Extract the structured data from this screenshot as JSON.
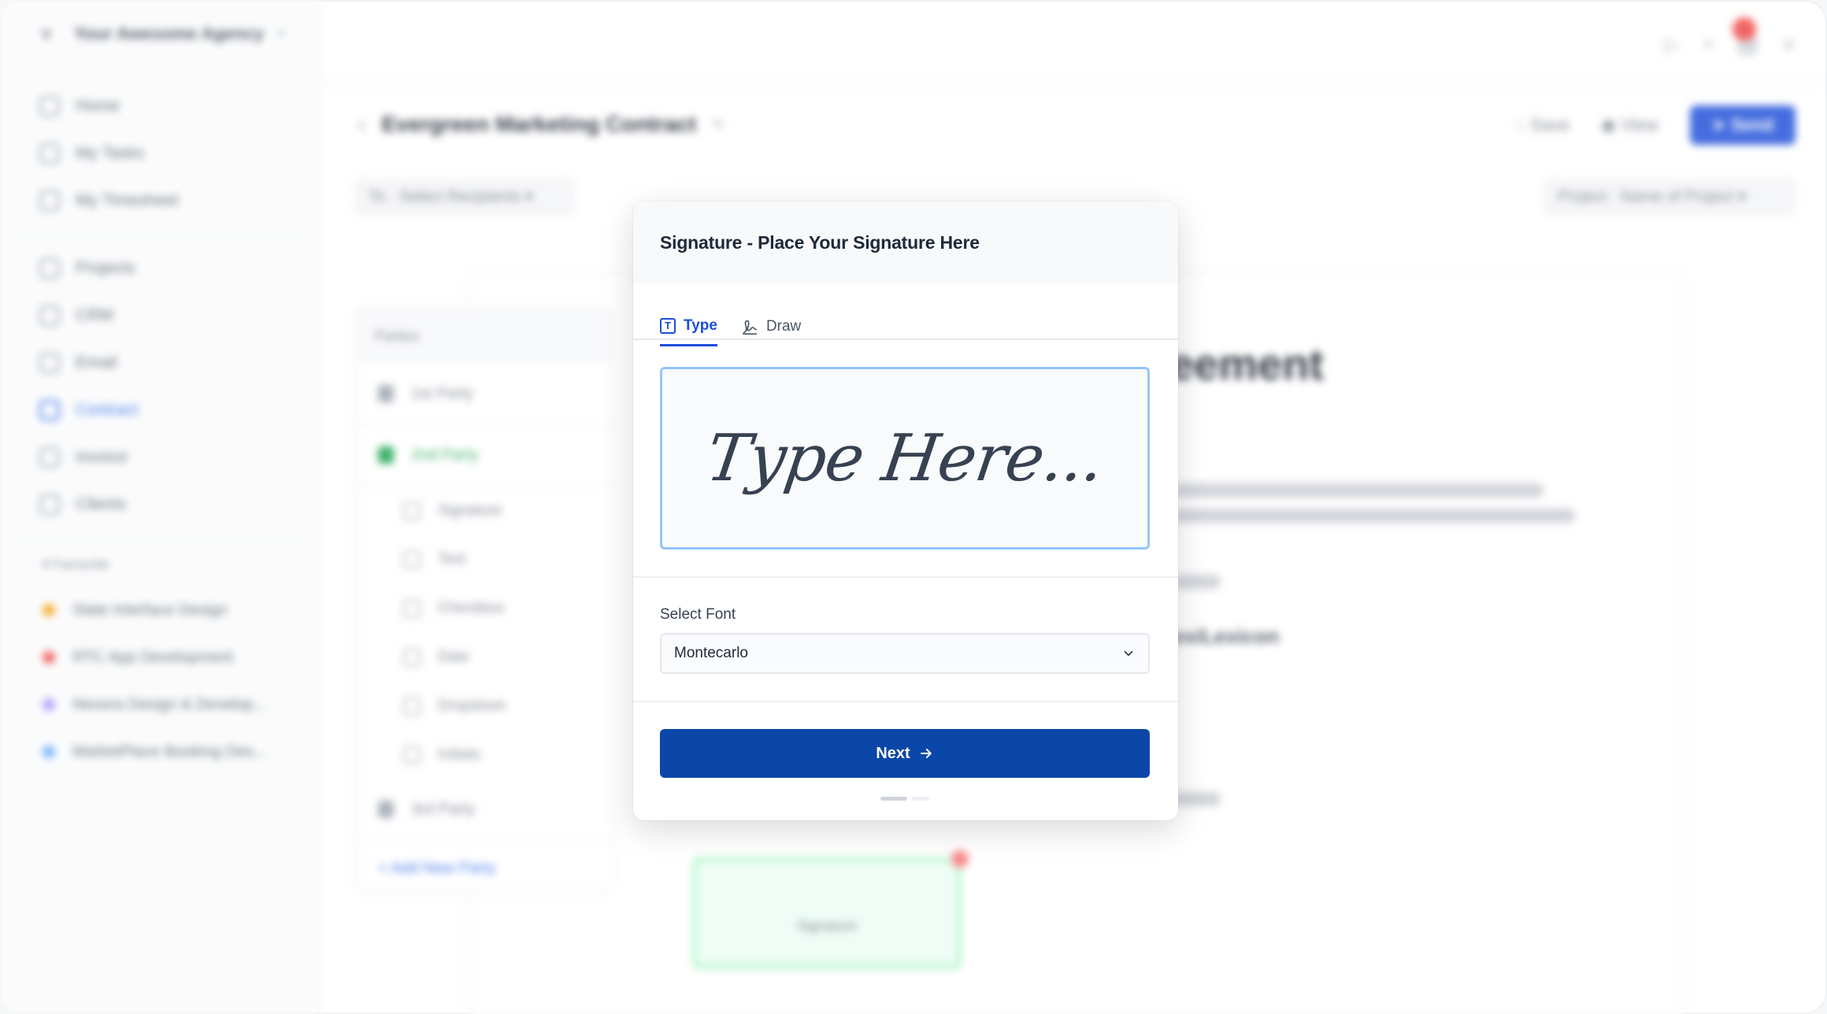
{
  "app": {
    "agency_name": "Your Awesome Agency"
  },
  "sidebar": {
    "items": [
      {
        "label": "Home",
        "icon": "home-icon"
      },
      {
        "label": "My Tasks",
        "icon": "tasks-icon"
      },
      {
        "label": "My Timesheet",
        "icon": "timesheet-icon"
      },
      {
        "label": "Projects",
        "icon": "projects-icon"
      },
      {
        "label": "CRM",
        "icon": "crm-icon"
      },
      {
        "label": "Email",
        "icon": "email-icon"
      },
      {
        "label": "Contract",
        "icon": "contract-icon",
        "active": true
      },
      {
        "label": "Invoice",
        "icon": "invoice-icon"
      },
      {
        "label": "Clients",
        "icon": "clients-icon"
      }
    ],
    "favourites_title": "Favourite",
    "favourites": [
      {
        "label": "Slate Interface Design",
        "color": "#f59e0b"
      },
      {
        "label": "RTC App Development",
        "color": "#ef4444"
      },
      {
        "label": "Nexora Design & Develop...",
        "color": "#a78bfa"
      },
      {
        "label": "MarketPlace Booking Des...",
        "color": "#60a5fa"
      }
    ]
  },
  "doc": {
    "title": "Evergreen Marketing Contract",
    "save_label": "Save",
    "view_label": "View",
    "send_label": "Send",
    "to_label": "To",
    "recipients_placeholder": "Select Recipients",
    "project_label": "Project",
    "project_placeholder": "Name of Project",
    "heading_partial": "eement",
    "strong_partial": "exiLexicon"
  },
  "parties_panel": {
    "title": "Parties",
    "party1": "1st Party",
    "party2": "2nd Party",
    "fields": [
      "Signature",
      "Text",
      "Checkbox",
      "Date",
      "Dropdown",
      "Initials"
    ],
    "party3": "3rd Party",
    "add_party": "Add New Party"
  },
  "signature_field": {
    "label": "Signature"
  },
  "modal": {
    "title": "Signature - Place Your Signature Here",
    "tabs": [
      {
        "label": "Type",
        "icon": "text-box-icon",
        "active": true
      },
      {
        "label": "Draw",
        "icon": "pen-signature-icon",
        "active": false
      }
    ],
    "placeholder": "Type Here...",
    "font_label": "Select Font",
    "font_value": "Montecarlo",
    "next_label": "Next",
    "steps_total": 2,
    "steps_current": 1
  },
  "colors": {
    "primary": "#0b47a8",
    "accent": "#1d4ed8",
    "sig_border": "#93c5fd"
  }
}
